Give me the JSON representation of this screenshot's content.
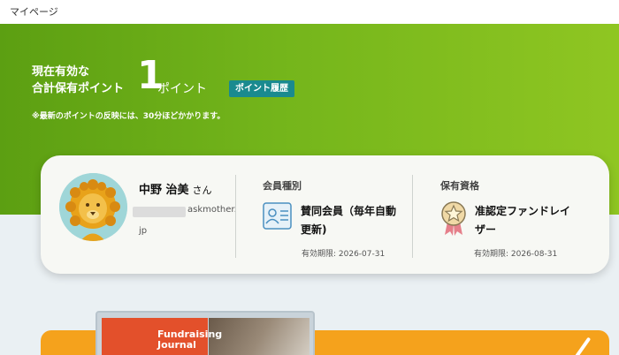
{
  "header": {
    "title": "マイページ"
  },
  "points": {
    "label_line1": "現在有効な",
    "label_line2": "合計保有ポイント",
    "value": "1",
    "unit": "ポイント",
    "history_button": "ポイント履歴",
    "note": "※最新のポイントの反映には、30分ほどかかります。"
  },
  "profile": {
    "name": "中野 治美",
    "honorific": "さん",
    "email_domain": "askmother.",
    "email_domain_tail": "jp"
  },
  "membership": {
    "title": "会員種別",
    "value_line1": "賛同会員（毎年自動",
    "value_line2": "更新)",
    "expiry": "有効期限: 2026-07-31",
    "icon": "id-card-icon"
  },
  "qualification": {
    "title": "保有資格",
    "value_line1": "准認定ファンドレイ",
    "value_line2": "ザー",
    "expiry": "有効期限: 2026-08-31",
    "icon": "award-badge-icon"
  },
  "banner": {
    "journal_title_line1": "Fundraising",
    "journal_title_line2": "Journal"
  },
  "colors": {
    "hero_green": "#74b51b",
    "teal_button": "#1a8a8f",
    "banner_orange": "#f5a21c"
  }
}
